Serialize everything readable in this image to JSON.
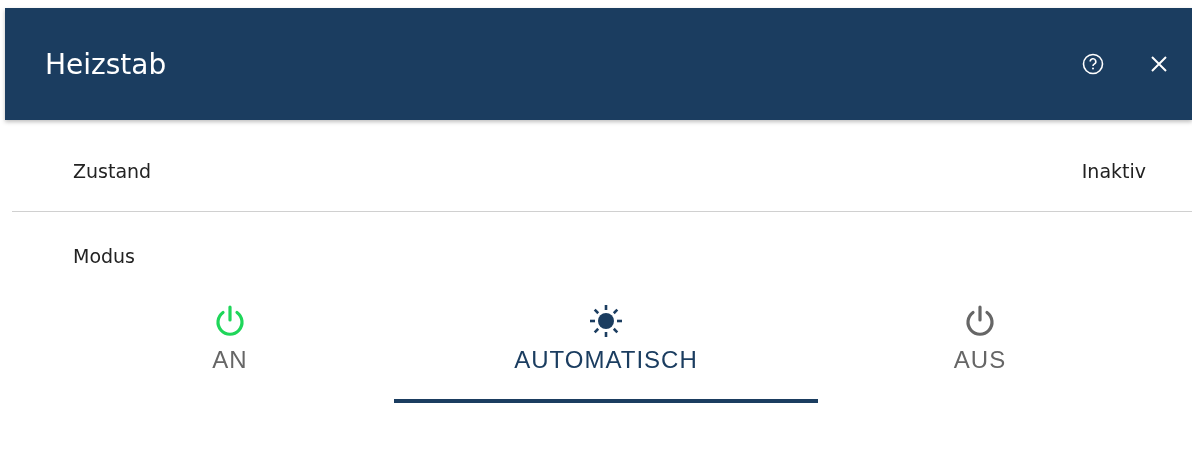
{
  "window": {
    "title": "Heizstab"
  },
  "rows": [
    {
      "label": "Zustand",
      "value": "Inaktiv"
    },
    {
      "label": "Modus"
    }
  ],
  "modes": [
    {
      "kind": "power",
      "label": "AN",
      "color": "#1fd65a",
      "selected": false
    },
    {
      "kind": "sun",
      "label": "AUTOMATISCH",
      "color": "#1b3d60",
      "selected": true
    },
    {
      "kind": "power",
      "label": "AUS",
      "color": "#666666",
      "selected": false
    }
  ]
}
